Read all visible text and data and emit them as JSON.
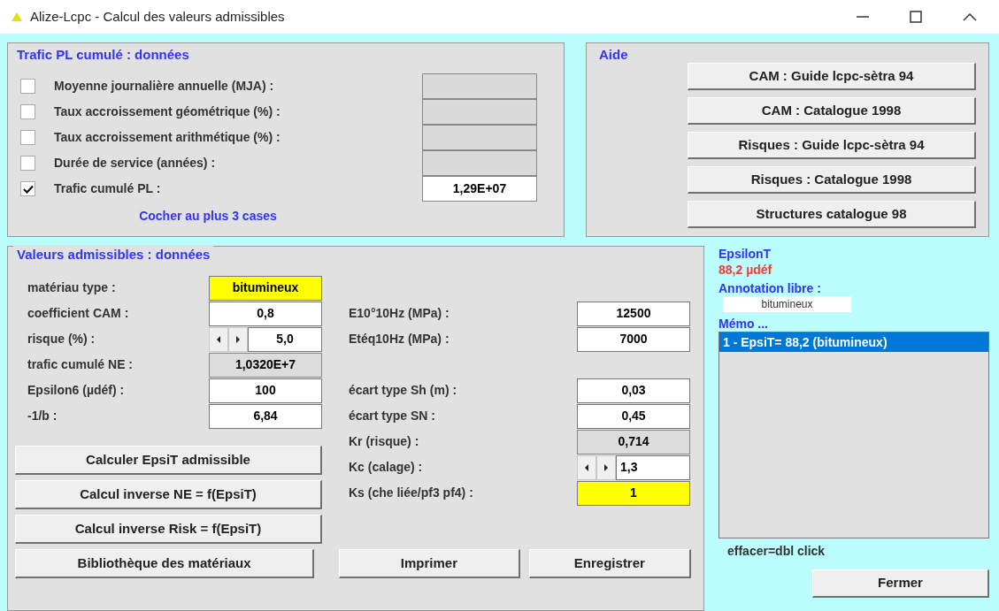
{
  "window": {
    "title": "Alize-Lcpc - Calcul des valeurs admissibles"
  },
  "traffic": {
    "title": "Trafic PL cumulé : données",
    "rows": [
      {
        "label": "Moyenne journalière annuelle (MJA) :",
        "checked": false
      },
      {
        "label": "Taux accroissement géométrique (%) :",
        "checked": false
      },
      {
        "label": "Taux accroissement arithmétique (%) :",
        "checked": false
      },
      {
        "label": "Durée de service  (années) :",
        "checked": false
      },
      {
        "label": "Trafic cumulé PL :",
        "checked": true,
        "value": "1,29E+07"
      }
    ],
    "hint": "Cocher au plus 3 cases"
  },
  "aide": {
    "title": "Aide",
    "buttons": [
      "CAM : Guide lcpc-sètra 94",
      "CAM : Catalogue 1998",
      "Risques : Guide lcpc-sètra 94",
      "Risques : Catalogue 1998",
      "Structures catalogue 98"
    ]
  },
  "valeurs": {
    "title": "Valeurs admissibles : données",
    "left_fields": [
      {
        "label": "matériau type :",
        "value": "bitumineux",
        "kind": "highlight"
      },
      {
        "label": "coefficient CAM :",
        "value": "0,8",
        "kind": "input"
      },
      {
        "label": "risque (%) :",
        "value": "5,0",
        "kind": "spin"
      },
      {
        "label": "trafic cumulé NE :",
        "value": "1,0320E+7",
        "kind": "readonly"
      },
      {
        "label": "Epsilon6 (µdéf) :",
        "value": "100",
        "kind": "input"
      },
      {
        "label": "-1/b :",
        "value": "6,84",
        "kind": "input"
      }
    ],
    "right_fields": [
      {
        "label": "E10°10Hz (MPa) :",
        "value": "12500",
        "kind": "input"
      },
      {
        "label": "Etéq10Hz (MPa) :",
        "value": "7000",
        "kind": "input"
      },
      {
        "kind": "gap"
      },
      {
        "label": "écart type Sh (m) :",
        "value": "0,03",
        "kind": "input"
      },
      {
        "label": "écart type SN :",
        "value": "0,45",
        "kind": "input"
      },
      {
        "label": "Kr (risque) :",
        "value": "0,714",
        "kind": "readonly"
      },
      {
        "label": "Kc (calage) :",
        "value": "1,3",
        "kind": "spin"
      },
      {
        "label": "Ks (che liée/pf3 pf4) :",
        "value": "1",
        "kind": "highlight"
      }
    ],
    "buttons": [
      "Calculer EpsiT admissible",
      "Calcul inverse NE = f(EpsiT)",
      "Calcul inverse Risk = f(EpsiT)",
      "Bibliothèque des matériaux"
    ],
    "bottom_buttons": [
      "Imprimer",
      "Enregistrer"
    ]
  },
  "result": {
    "label": "EpsilonT",
    "value": "88,2 µdéf"
  },
  "annotation": {
    "label": "Annotation libre :",
    "value": "bitumineux"
  },
  "memo": {
    "label": "Mémo ...",
    "items": [
      {
        "text": "1 - EpsiT= 88,2 (bitumineux)",
        "selected": true
      }
    ],
    "hint": "effacer=dbl click"
  },
  "close_button": "Fermer"
}
